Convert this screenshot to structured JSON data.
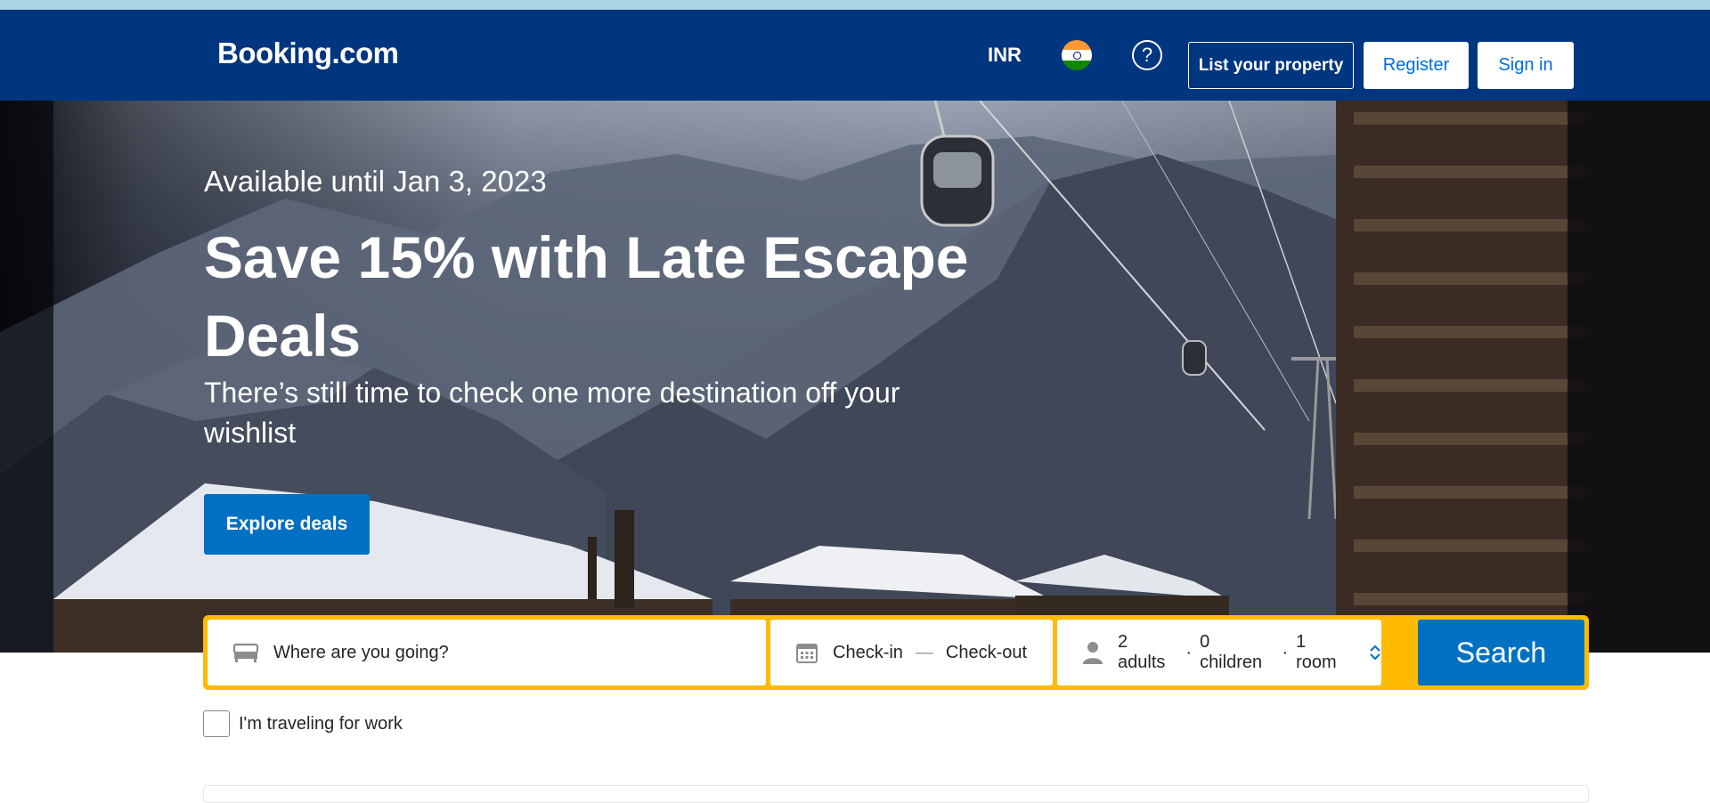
{
  "header": {
    "logo": "Booking.com",
    "currency": "INR",
    "flag_icon": "india-flag-icon",
    "help_icon": "question-mark-icon",
    "list_property": "List your property",
    "register": "Register",
    "sign_in": "Sign in",
    "bg_color": "#003580"
  },
  "hero": {
    "eyebrow": "Available until Jan 3, 2023",
    "title": "Save 15% with Late Escape Deals",
    "subtitle": "There’s still time to check one more destination off your wishlist",
    "cta": "Explore deals"
  },
  "search": {
    "destination_placeholder": "Where are you going?",
    "destination_icon": "bed-icon",
    "checkin": "Check-in",
    "checkout": "Check-out",
    "date_icon": "calendar-icon",
    "guests_icon": "person-icon",
    "adults": "2 adults",
    "children": "0 children",
    "rooms": "1 room",
    "separator": "·",
    "dash": "—",
    "search_button": "Search",
    "accent": "#febb02",
    "button_color": "#0071c2"
  },
  "work_travel": {
    "label": "I'm traveling for work",
    "checked": false
  }
}
